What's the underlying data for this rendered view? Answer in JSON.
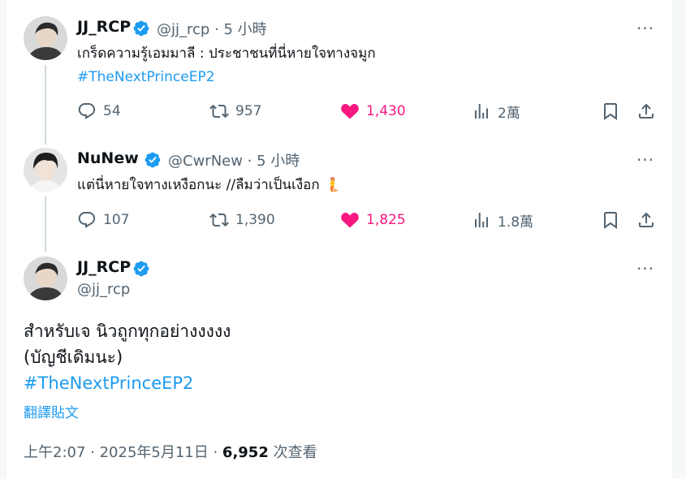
{
  "tweets": [
    {
      "name": "JJ_RCP",
      "handle": "@jj_rcp",
      "time": " · 5 小時",
      "text": "เกร็ดความรู้เอมมาลี : ประชาชนที่นี่หายใจทางจมูก",
      "hashtag": "#TheNextPrinceEP2",
      "replies": "54",
      "reposts": "957",
      "likes": "1,430",
      "views": "2萬"
    },
    {
      "name": "NuNew",
      "handle": "@CwrNew",
      "time": " · 5 小時",
      "text": "แต่นี่หายใจทางเหงือกนะ //ลืมว่าเป็นเงือก 🧜",
      "replies": "107",
      "reposts": "1,390",
      "likes": "1,825",
      "views": "1.8萬"
    }
  ],
  "main": {
    "name": "JJ_RCP",
    "handle": "@jj_rcp",
    "line1": "สำหรับเจ นิวถูกทุกอย่างงงงง",
    "line2": "(บัญชีเดิมนะ)",
    "hashtag": "#TheNextPrinceEP2",
    "translate": "翻譯貼文",
    "timestamp": "上午2:07 · 2025年5月11日 · ",
    "views": "6,952",
    "views_label": " 次查看"
  },
  "colors": {
    "accent": "#1d9bf0",
    "like": "#f91880",
    "muted": "#536471"
  },
  "icons": [
    "verified-badge-icon",
    "reply-icon",
    "repost-icon",
    "like-icon",
    "views-icon",
    "bookmark-icon",
    "share-icon",
    "more-icon"
  ]
}
